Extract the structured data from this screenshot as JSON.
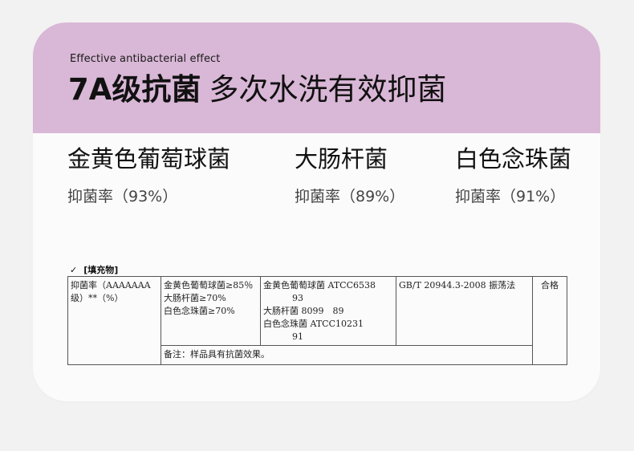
{
  "header": {
    "subtitle": "Effective antibacterial effect",
    "title_bold": "7A级抗菌",
    "title_light": "多次水洗有效抑菌"
  },
  "bacteria": [
    {
      "name": "金黄色葡萄球菌",
      "rate": "抑菌率（93%）"
    },
    {
      "name": "大肠杆菌",
      "rate": "抑菌率（89%）"
    },
    {
      "name": "白色念珠菌",
      "rate": "抑菌率（91%）"
    }
  ],
  "report": {
    "check_mark": "✓",
    "section_label": "[填充物]",
    "row": {
      "item_line1": "抑菌率（AAAAAAA",
      "item_line2": "级）**（%）",
      "requirement": [
        "金黄色葡萄球菌≥85％",
        "大肠杆菌≥70%",
        "白色念珠菌≥70%"
      ],
      "result": {
        "line1": "金黄色葡萄球菌 ATCC6538",
        "line2": "93",
        "line3": "大肠杆菌 8099　89",
        "line4": "白色念珠菌 ATCC10231",
        "line5": "91"
      },
      "method": "GB/T 20944.3-2008  振荡法",
      "verdict": "合格"
    },
    "note": "备注：样品具有抗菌效果。"
  },
  "colors": {
    "header_bg": "#d9b7d6",
    "card_bg": "#fbfbfb",
    "page_bg": "#f3f2f3"
  }
}
